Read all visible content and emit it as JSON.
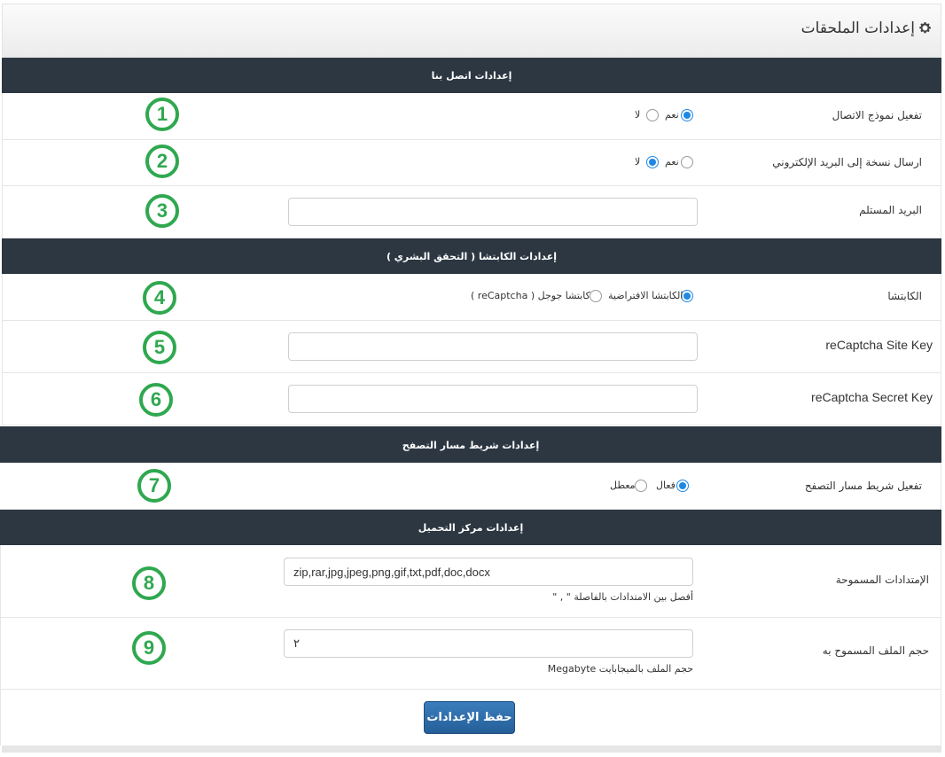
{
  "header": {
    "title": "إعدادات الملحقات",
    "icon": "gear-icon"
  },
  "sections": {
    "contact": "إعدادات اتصل بنا",
    "captcha": "إعدادات الكابتشا ( التحقق البشري )",
    "breadcrumb": "إعدادات شريط مسار التصفح",
    "upload": "إعدادات مركز التحميل"
  },
  "fields": {
    "contact_form": {
      "label": "تفعيل نموذج الاتصال",
      "options": [
        "نعم",
        "لا"
      ],
      "selected": "نعم"
    },
    "email_copy": {
      "label": "ارسال نسخة إلى البريد الإلكتروني",
      "options": [
        "نعم",
        "لا"
      ],
      "selected": "لا"
    },
    "recipient_email": {
      "label": "البريد المستلم",
      "value": ""
    },
    "captcha_type": {
      "label": "الكابتشا",
      "options": [
        "الكابتشا الافتراضية",
        "كابتشا جوجل ( reCaptcha )"
      ],
      "selected": "الكابتشا الافتراضية"
    },
    "site_key": {
      "label": "reCaptcha Site Key",
      "value": ""
    },
    "secret_key": {
      "label": "reCaptcha Secret Key",
      "value": ""
    },
    "breadcrumb_enabled": {
      "label": "تفعيل شريط مسار التصفح",
      "options": [
        "فعال",
        "معطل"
      ],
      "selected": "فعال"
    },
    "allowed_extensions": {
      "label": "الإمتدادات المسموحة",
      "value": "zip,rar,jpg,jpeg,png,gif,txt,pdf,doc,docx",
      "help": "أفصل بين الامتدادات بالفاصلة \" , \""
    },
    "max_file_size": {
      "label": "حجم الملف المسموح به",
      "value": "٢",
      "help": "حجم الملف بالميجابايت Megabyte"
    }
  },
  "markers": [
    "1",
    "2",
    "3",
    "4",
    "5",
    "6",
    "7",
    "8",
    "9"
  ],
  "save_button": "حفظ الإعدادات",
  "colors": {
    "section_bar": "#2c3742",
    "accent": "#1e88e5",
    "marker": "#2fa84f",
    "button": "#2e6da4"
  }
}
